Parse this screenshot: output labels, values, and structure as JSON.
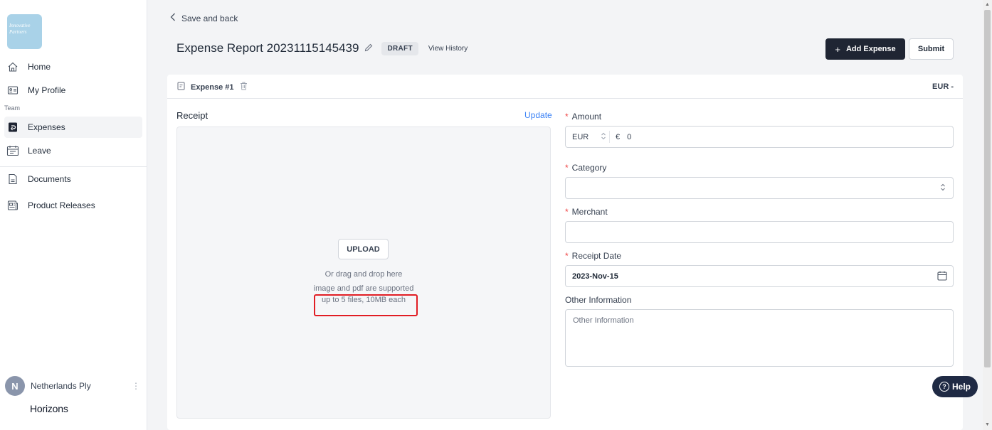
{
  "sidebar": {
    "logo_text": "Innovative Partners",
    "items": [
      {
        "label": "Home",
        "icon": "home-icon"
      },
      {
        "label": "My Profile",
        "icon": "id-card-icon"
      },
      {
        "label": "Expenses",
        "icon": "expenses-icon"
      },
      {
        "label": "Leave",
        "icon": "calendar-icon"
      },
      {
        "label": "Documents",
        "icon": "document-icon"
      },
      {
        "label": "Product Releases",
        "icon": "news-icon"
      }
    ],
    "section_team": "Team",
    "user": {
      "initial": "N",
      "name": "Netherlands Ply"
    },
    "brand": "Horizons"
  },
  "header": {
    "back_label": "Save and back",
    "title": "Expense Report 20231115145439",
    "status": "DRAFT",
    "history_label": "View History",
    "add_label": "Add Expense",
    "submit_label": "Submit"
  },
  "expense": {
    "label": "Expense #1",
    "currency_summary": "EUR -"
  },
  "receipt": {
    "label": "Receipt",
    "update_label": "Update",
    "upload_label": "UPLOAD",
    "hint_drag": "Or drag and drop here",
    "hint_types": "image and pdf are supported",
    "hint_limits": "up to 5 files, 10MB each"
  },
  "form": {
    "amount_label": "Amount",
    "currency": "EUR",
    "currency_symbol": "€",
    "amount_value": "0",
    "category_label": "Category",
    "category_value": "",
    "merchant_label": "Merchant",
    "merchant_value": "",
    "date_label": "Receipt Date",
    "date_value": "2023-Nov-15",
    "other_label": "Other Information",
    "other_placeholder": "Other Information"
  },
  "help_label": "Help",
  "colors": {
    "primary_button": "#1f2533",
    "highlight_box": "#e11d24",
    "link": "#3b82f6",
    "required": "#ef4444"
  }
}
